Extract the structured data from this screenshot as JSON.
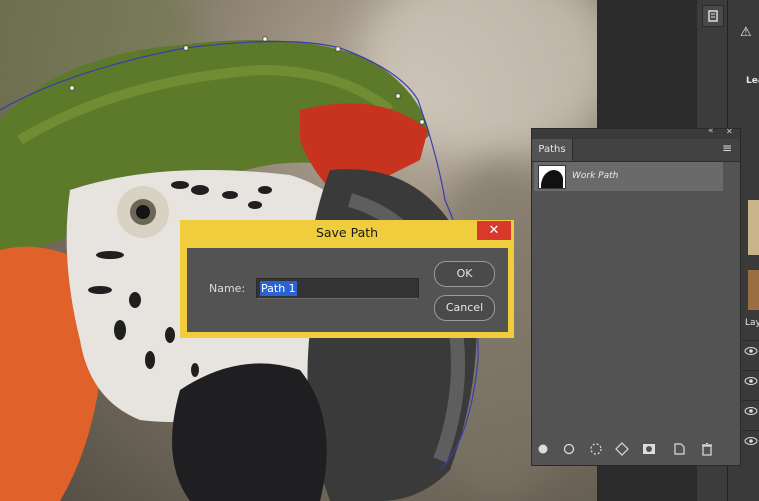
{
  "dialog": {
    "title": "Save Path",
    "close_glyph": "✕",
    "name_label": "Name:",
    "name_value": "Path 1",
    "ok_label": "OK",
    "cancel_label": "Cancel"
  },
  "paths_panel": {
    "tab_label": "Paths",
    "menu_glyph": "≡",
    "collapse_glyph": "«",
    "close_glyph": "✕",
    "items": [
      {
        "label": "Work Path"
      }
    ],
    "footer_icons": [
      "fill-path-icon",
      "stroke-path-icon",
      "load-as-selection-icon",
      "make-work-path-icon",
      "add-mask-icon",
      "new-path-icon",
      "delete-path-icon"
    ]
  },
  "right_dock": {
    "text_lea": "Lea",
    "text_lay": "Lay",
    "warning_glyph": "⚠"
  },
  "colors": {
    "dialog_title_bg": "#f0cd3c",
    "close_red": "#d9392b",
    "selection_blue": "#2a62d6"
  }
}
